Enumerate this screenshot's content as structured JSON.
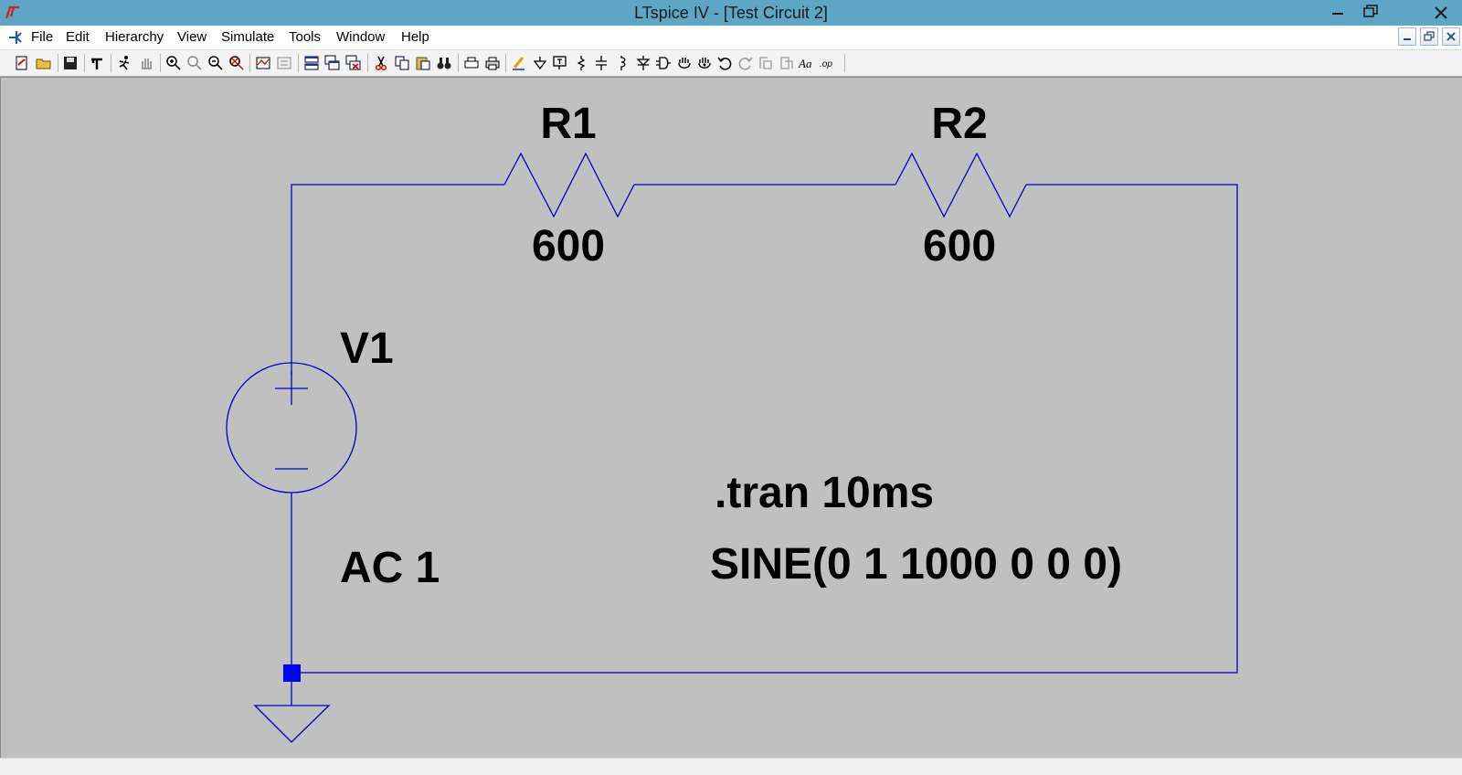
{
  "window": {
    "title": "LTspice IV - [Test Circuit 2]",
    "controls": [
      "minimize",
      "restore",
      "close"
    ]
  },
  "menubar": {
    "items": [
      {
        "label": "File",
        "name": "file"
      },
      {
        "label": "Edit",
        "name": "edit"
      },
      {
        "label": "Hierarchy",
        "name": "hierarchy"
      },
      {
        "label": "View",
        "name": "view"
      },
      {
        "label": "Simulate",
        "name": "simulate"
      },
      {
        "label": "Tools",
        "name": "tools"
      },
      {
        "label": "Window",
        "name": "window"
      },
      {
        "label": "Help",
        "name": "help"
      }
    ]
  },
  "toolbar": {
    "icons": [
      "new-schematic-icon",
      "open-icon",
      "save-icon",
      "control-panel-icon",
      "run-icon",
      "halt-icon",
      "zoom-in-icon",
      "pan-icon",
      "zoom-out-icon",
      "zoom-fit-icon",
      "autorange-icon",
      "voltage-probe-icon",
      "tile-horizontal-icon",
      "cascade-icon",
      "close-all-icon",
      "cut-icon",
      "copy-icon",
      "paste-icon",
      "find-icon",
      "print-setup-icon",
      "print-icon",
      "wire-icon",
      "ground-icon",
      "label-net-icon",
      "resistor-icon",
      "capacitor-icon",
      "inductor-icon",
      "diode-icon",
      "component-icon",
      "move-icon",
      "drag-icon",
      "undo-icon",
      "redo-icon",
      "rotate-icon",
      "mirror-icon",
      "text-icon",
      "spice-directive-icon"
    ]
  },
  "schematic": {
    "colors": {
      "background": "#c0c0c0",
      "wire": "#0000c0",
      "junction": "#0000ff",
      "text": "#000000"
    },
    "components": {
      "r1": {
        "name": "R1",
        "value": "600"
      },
      "r2": {
        "name": "R2",
        "value": "600"
      },
      "v1": {
        "name": "V1",
        "value": "AC 1"
      }
    },
    "directives": {
      "tran": ".tran 10ms",
      "source": "SINE(0 1 1000 0 0 0)"
    }
  }
}
